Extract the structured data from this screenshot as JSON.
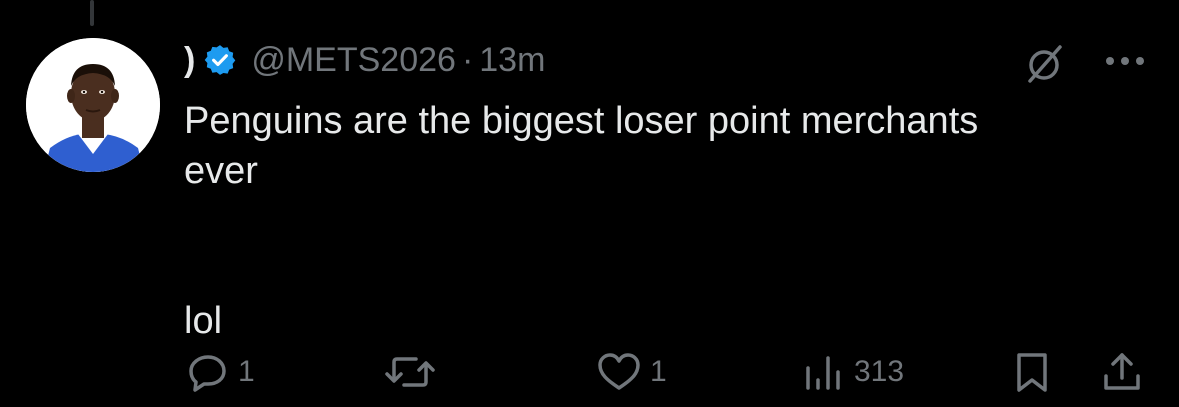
{
  "tweet": {
    "display_name": ")",
    "handle": "@METS2026",
    "separator": "·",
    "time": "13m",
    "text_lines": [
      "Penguins are the biggest loser point merchants",
      "ever"
    ],
    "text_after_break": "lol",
    "verified": true
  },
  "actions": {
    "reply_count": "1",
    "retweet_count": "",
    "like_count": "1",
    "views_count": "313"
  },
  "icons": {
    "verified": "verified-badge-icon",
    "grok": "grok-icon",
    "more": "more-icon",
    "reply": "reply-icon",
    "retweet": "retweet-icon",
    "like": "heart-icon",
    "views": "views-icon",
    "bookmark": "bookmark-icon",
    "share": "share-icon"
  },
  "colors": {
    "background": "#000000",
    "text": "#e7e9ea",
    "secondary": "#71767b",
    "verified_blue": "#1d9bf0"
  }
}
